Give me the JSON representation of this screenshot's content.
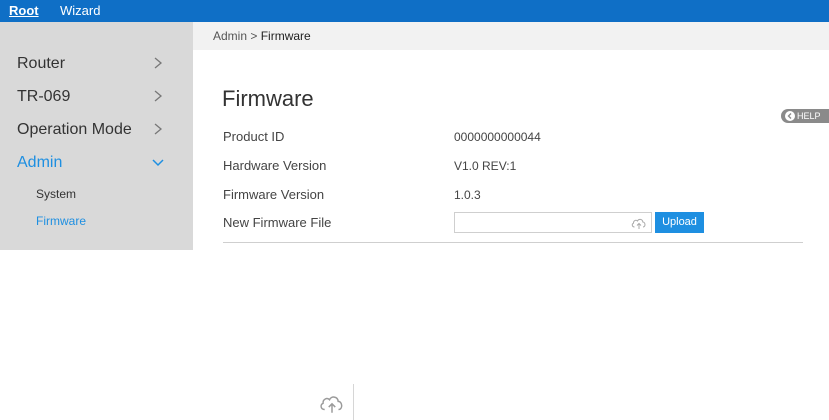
{
  "topbar": {
    "tabs": [
      {
        "label": "Root"
      },
      {
        "label": "Wizard"
      }
    ]
  },
  "sidebar": {
    "items": [
      {
        "label": "Router",
        "icon": "chevron-right-icon"
      },
      {
        "label": "TR-069",
        "icon": "chevron-right-icon"
      },
      {
        "label": "Operation Mode",
        "icon": "chevron-right-icon"
      },
      {
        "label": "Admin",
        "icon": "chevron-down-icon",
        "active": true
      }
    ],
    "subitems": [
      {
        "label": "System"
      },
      {
        "label": "Firmware",
        "active": true
      }
    ]
  },
  "breadcrumb": {
    "parent": "Admin",
    "separator": " > ",
    "current": "Firmware"
  },
  "main": {
    "title": "Firmware",
    "help_label": "HELP",
    "rows": [
      {
        "label": "Product ID",
        "value": "0000000000044"
      },
      {
        "label": "Hardware Version",
        "value": "V1.0 REV:1"
      },
      {
        "label": "Firmware Version",
        "value": "1.0.3"
      },
      {
        "label": "New Firmware File"
      }
    ],
    "file_input": {
      "value": "",
      "icon": "cloud-upload-icon"
    },
    "upload_label": "Upload"
  },
  "colors": {
    "accent": "#1e8fe1",
    "topbar": "#0f6fc6",
    "sidebar": "#d9d9d9",
    "help": "#8a8a8a"
  }
}
